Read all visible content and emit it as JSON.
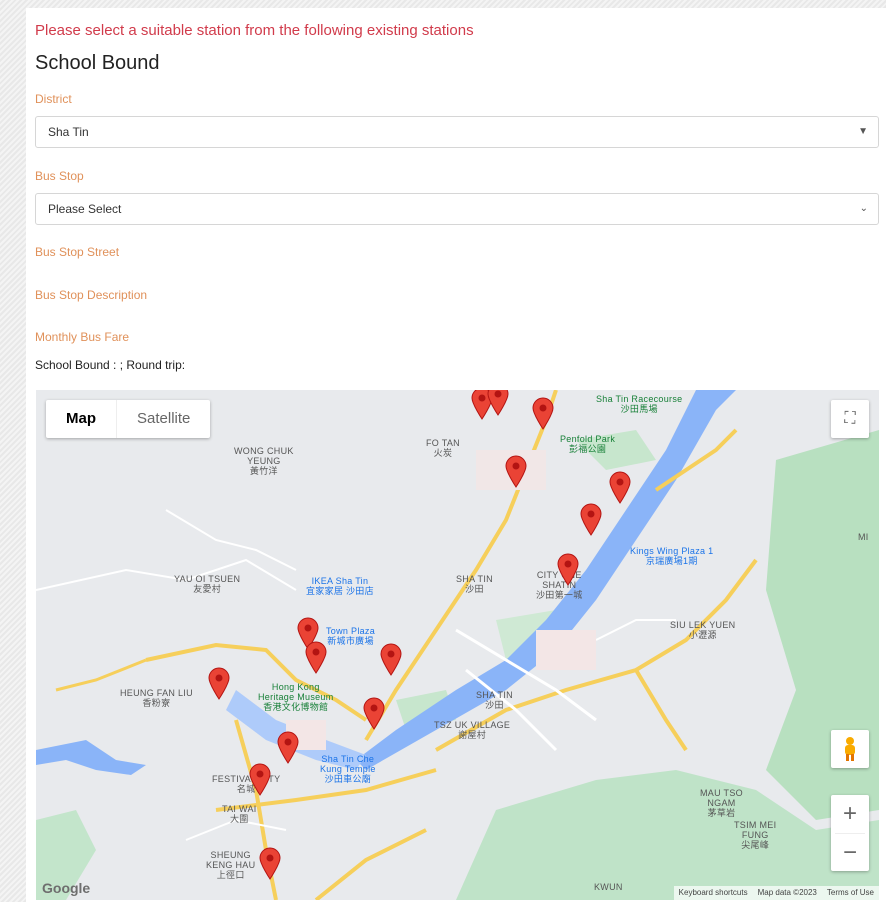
{
  "notice": "Please select a suitable station from the following existing stations",
  "heading": "School Bound",
  "district": {
    "label": "District",
    "value": "Sha Tin"
  },
  "bus_stop": {
    "label": "Bus Stop",
    "value": "Please Select"
  },
  "bus_stop_street": {
    "label": "Bus Stop Street"
  },
  "bus_stop_description": {
    "label": "Bus Stop Description"
  },
  "monthly_bus_fare": {
    "label": "Monthly Bus Fare",
    "text": "School Bound : ; Round trip:"
  },
  "map": {
    "map_type_map": "Map",
    "map_type_satellite": "Satellite",
    "zoom_in": "+",
    "zoom_out": "−",
    "logo": "Google",
    "footer": {
      "shortcuts": "Keyboard shortcuts",
      "data": "Map data ©2023",
      "terms": "Terms of Use"
    },
    "labels": {
      "wong_chuk_yeung": "WONG CHUK\nYEUNG\n黃竹洋",
      "fo_tan": "FO TAN\n火炭",
      "racecourse": "Sha Tin Racecourse\n沙田馬場",
      "penfold": "Penfold Park\n彭福公園",
      "yau_oi": "YAU OI TSUEN\n友愛村",
      "ikea": "IKEA Sha Tin\n宜家家居 沙田店",
      "sha_tin_upper": "SHA TIN\n沙田",
      "city_one": "CITY ONE\nSHATIN\n沙田第一城",
      "kings_wing": "Kings Wing Plaza 1\n京瑞廣場1期",
      "town_plaza": "Town Plaza\n新城市廣場",
      "siu_lek_yuen": "SIU LEK YUEN\n小瀝源",
      "heung_fan_liu": "HEUNG FAN LIU\n香粉寮",
      "hk_heritage": "Hong Kong\nHeritage Museum\n香港文化博物館",
      "sha_tin_lower": "SHA TIN\n沙田",
      "tsz_uk": "TSZ UK VILLAGE\n謝屋村",
      "che_kung": "Sha Tin Che\nKung Temple\n沙田車公廟",
      "festival_city": "FESTIVAL CITY\n名城",
      "tai_wai": "TAI WAI\n大圍",
      "sheung_keng_hau": "SHEUNG\nKENG HAU\n上徑口",
      "ma_on_shan": "MAU TSO\nNGAM\n茅草岩",
      "tsim_mei": "TSIM MEI\nFUNG\n尖尾峰",
      "kwun": "KWUN",
      "mi": "MI"
    }
  }
}
